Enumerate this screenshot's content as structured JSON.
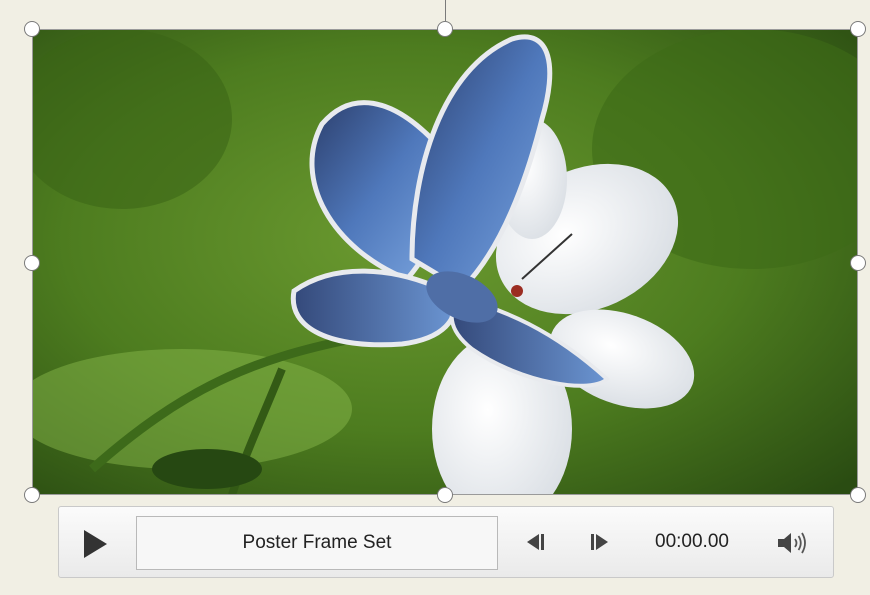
{
  "player": {
    "status_text": "Poster Frame Set",
    "timecode": "00:00.00"
  },
  "icons": {
    "play": "play-icon",
    "previous_frame": "step-back-icon",
    "next_frame": "step-forward-icon",
    "volume": "speaker-icon"
  },
  "colors": {
    "background": "#f1efe4",
    "video_green": "#4b7a1f",
    "butterfly_blue": "#5d86c6"
  }
}
